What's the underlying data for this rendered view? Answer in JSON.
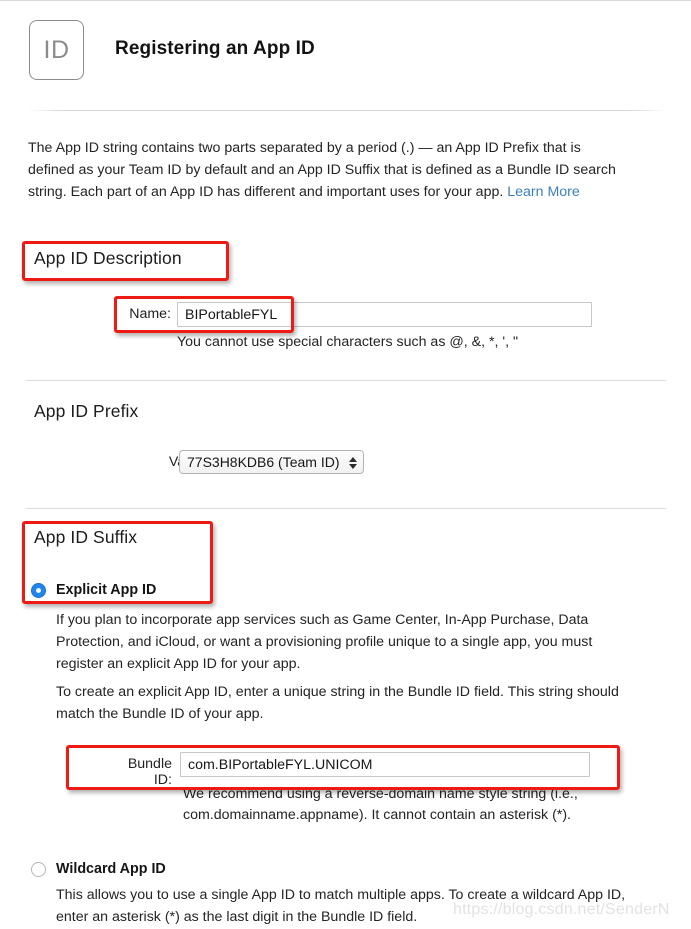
{
  "header": {
    "icon_label": "ID",
    "title": "Registering an App ID"
  },
  "intro": {
    "text": "The App ID string contains two parts separated by a period (.) — an App ID Prefix that is defined as your Team ID by default and an App ID Suffix that is defined as a Bundle ID search string. Each part of an App ID has different and important uses for your app. ",
    "link_label": "Learn More"
  },
  "description_section": {
    "heading": "App ID Description",
    "name_label": "Name:",
    "name_value": "BIPortableFYL",
    "name_helper": "You cannot use special characters such as @, &, *, ', \""
  },
  "prefix_section": {
    "heading": "App ID Prefix",
    "value_label": "Value:",
    "value_selected": "77S3H8KDB6 (Team ID)"
  },
  "suffix_section": {
    "heading": "App ID Suffix",
    "explicit": {
      "radio_label": "Explicit App ID",
      "selected": true,
      "paragraph_1": "If you plan to incorporate app services such as Game Center, In-App Purchase, Data Protection, and iCloud, or want a provisioning profile unique to a single app, you must register an explicit App ID for your app.",
      "paragraph_2": "To create an explicit App ID, enter a unique string in the Bundle ID field. This string should match the Bundle ID of your app.",
      "bundle_label": "Bundle ID:",
      "bundle_value": "com.BIPortableFYL.UNICOM",
      "bundle_helper": "We recommend using a reverse-domain name style string (i.e., com.domainname.appname). It cannot contain an asterisk (*)."
    },
    "wildcard": {
      "radio_label": "Wildcard App ID",
      "selected": false,
      "paragraph": "This allows you to use a single App ID to match multiple apps. To create a wildcard App ID, enter an asterisk (*) as the last digit in the Bundle ID field."
    }
  },
  "watermark": {
    "text": "https://blog.csdn.net/SenderN"
  },
  "colors": {
    "annotation_red": "#ee1b15",
    "link_blue": "#3d7fc1",
    "radio_blue": "#1f86ee"
  }
}
